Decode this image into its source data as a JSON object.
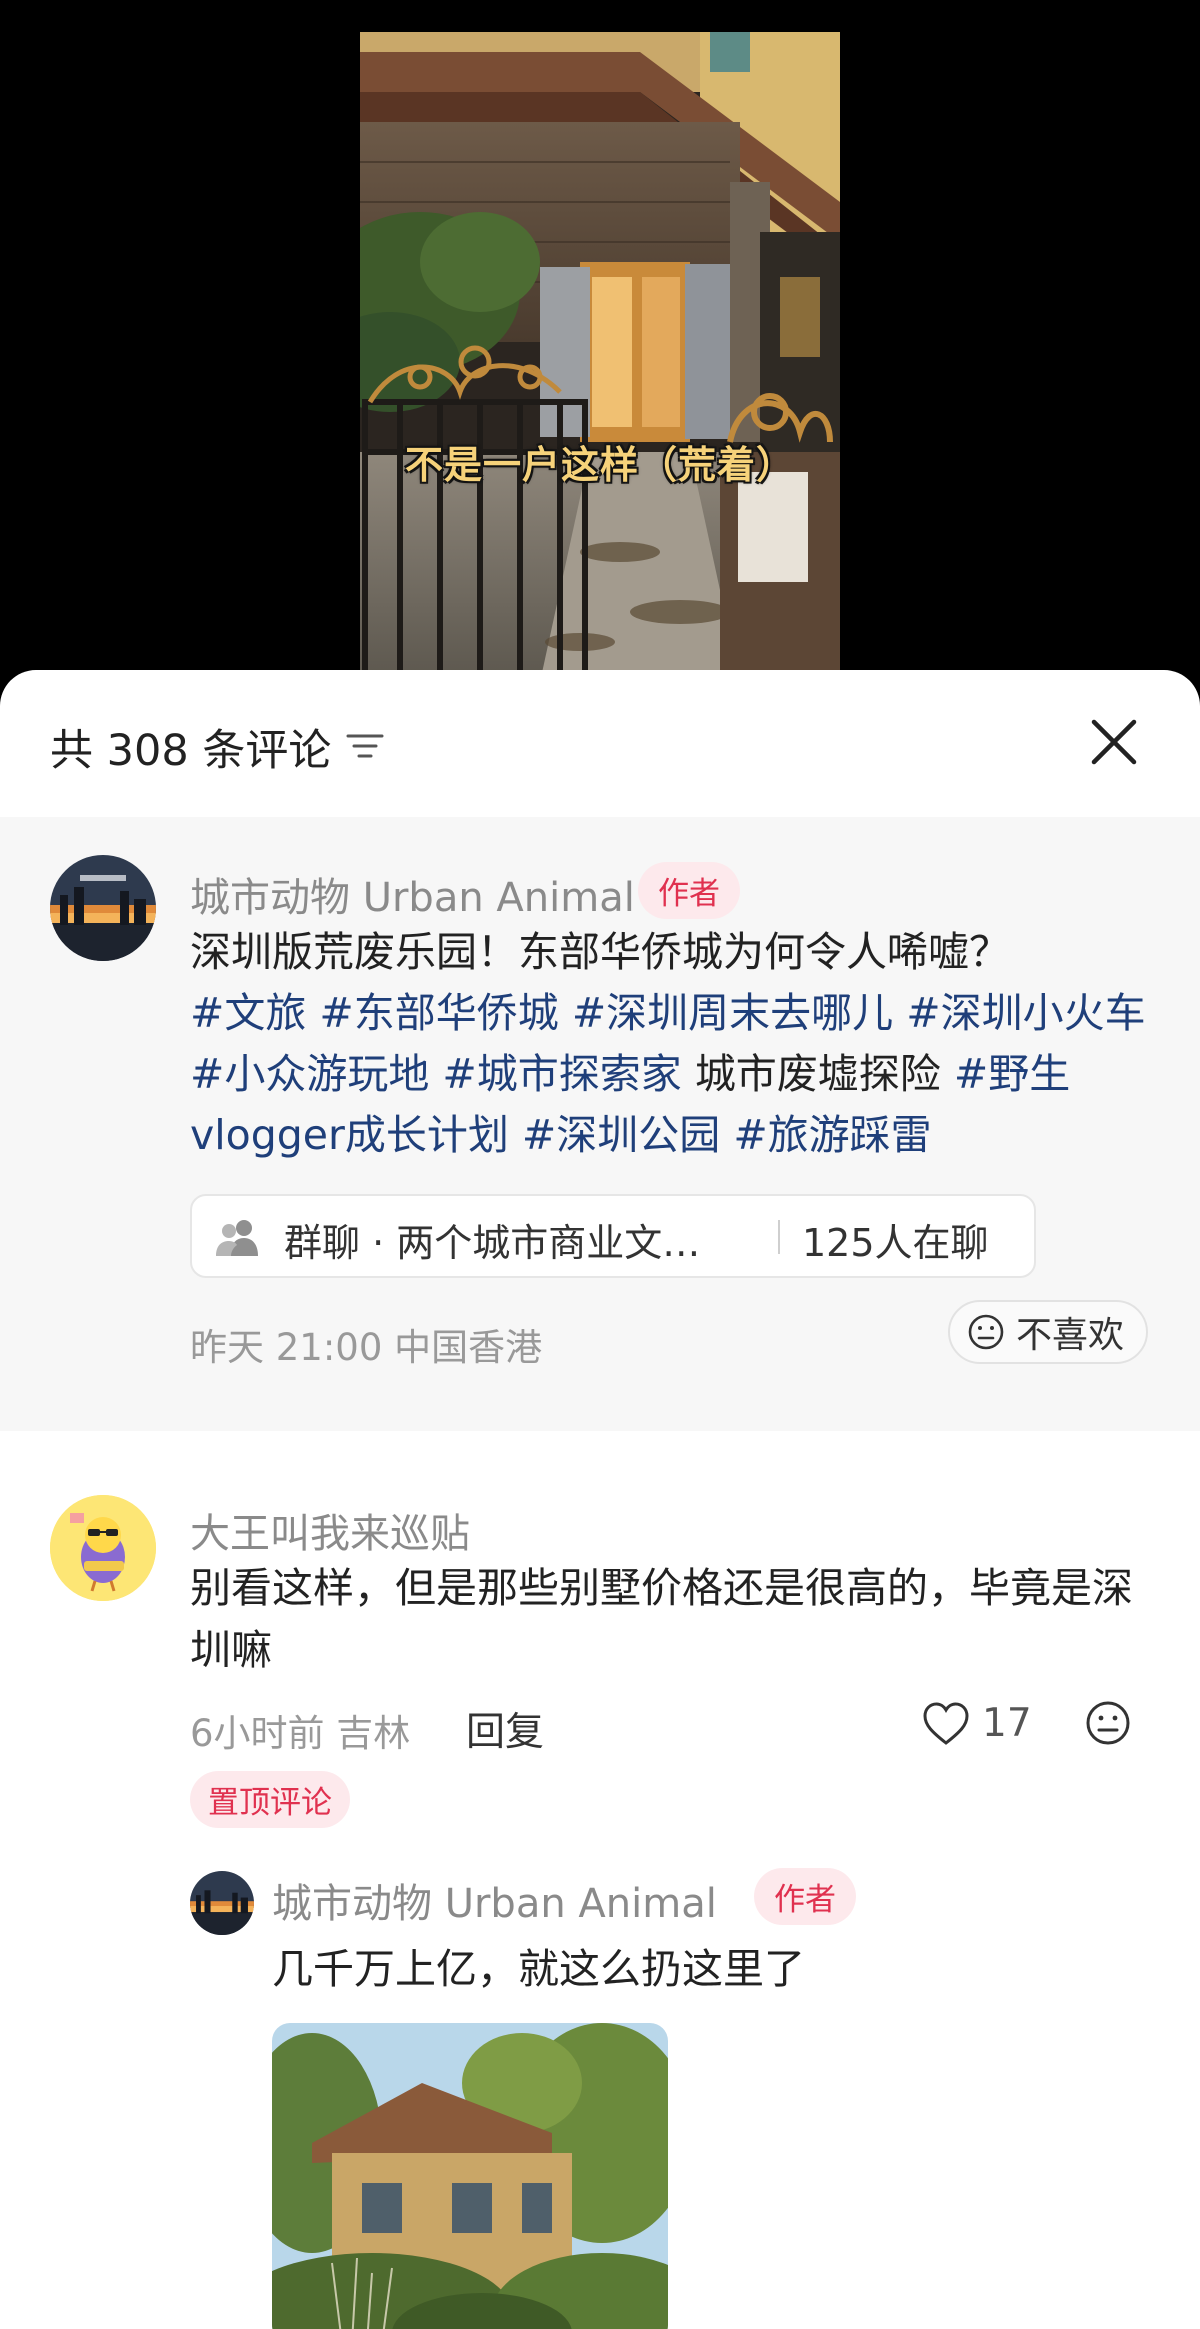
{
  "video": {
    "caption": "不是一户这样（荒着）"
  },
  "header": {
    "comment_count": "共 308 条评论",
    "sort_icon": "filter-lines-icon",
    "close_icon": "close-icon"
  },
  "author_post": {
    "author_name": "城市动物 Urban Animal",
    "author_badge": "作者",
    "text_line1": "深圳版荒废乐园！东部华侨城为何令人唏嘘？",
    "tags": [
      "#文旅",
      "#东部华侨城",
      "#深圳周末去哪儿",
      "#深圳小火车",
      "#小众游玩地",
      "#城市探索家",
      "城市废墟探险",
      "#野生vlogger成长计划",
      "#深圳公园",
      "#旅游踩雷"
    ],
    "group_chat": {
      "icon": "group-people-icon",
      "name": "群聊 · 两个城市商业文…",
      "online": "125人在聊"
    },
    "meta": "昨天 21:00 中国香港",
    "dislike_label": "不喜欢",
    "dislike_icon": "meh-face-icon"
  },
  "comment": {
    "username": "大王叫我来巡贴",
    "text": "别看这样，但是那些别墅价格还是很高的，毕竟是深圳嘛",
    "meta": "6小时前 吉林",
    "reply_label": "回复",
    "like_icon": "heart-icon",
    "like_count": "17",
    "emoji_icon": "meh-face-icon",
    "pinned_label": "置顶评论",
    "reply": {
      "username": "城市动物 Urban Animal",
      "badge": "作者",
      "text": "几千万上亿，就这么扔这里了"
    }
  },
  "colors": {
    "accent_red": "#e0314f",
    "badge_bg": "#fde9ec",
    "tag_blue": "#1f3f7a",
    "meta_gray": "#999999",
    "caption_yellow": "#f6d27a"
  }
}
